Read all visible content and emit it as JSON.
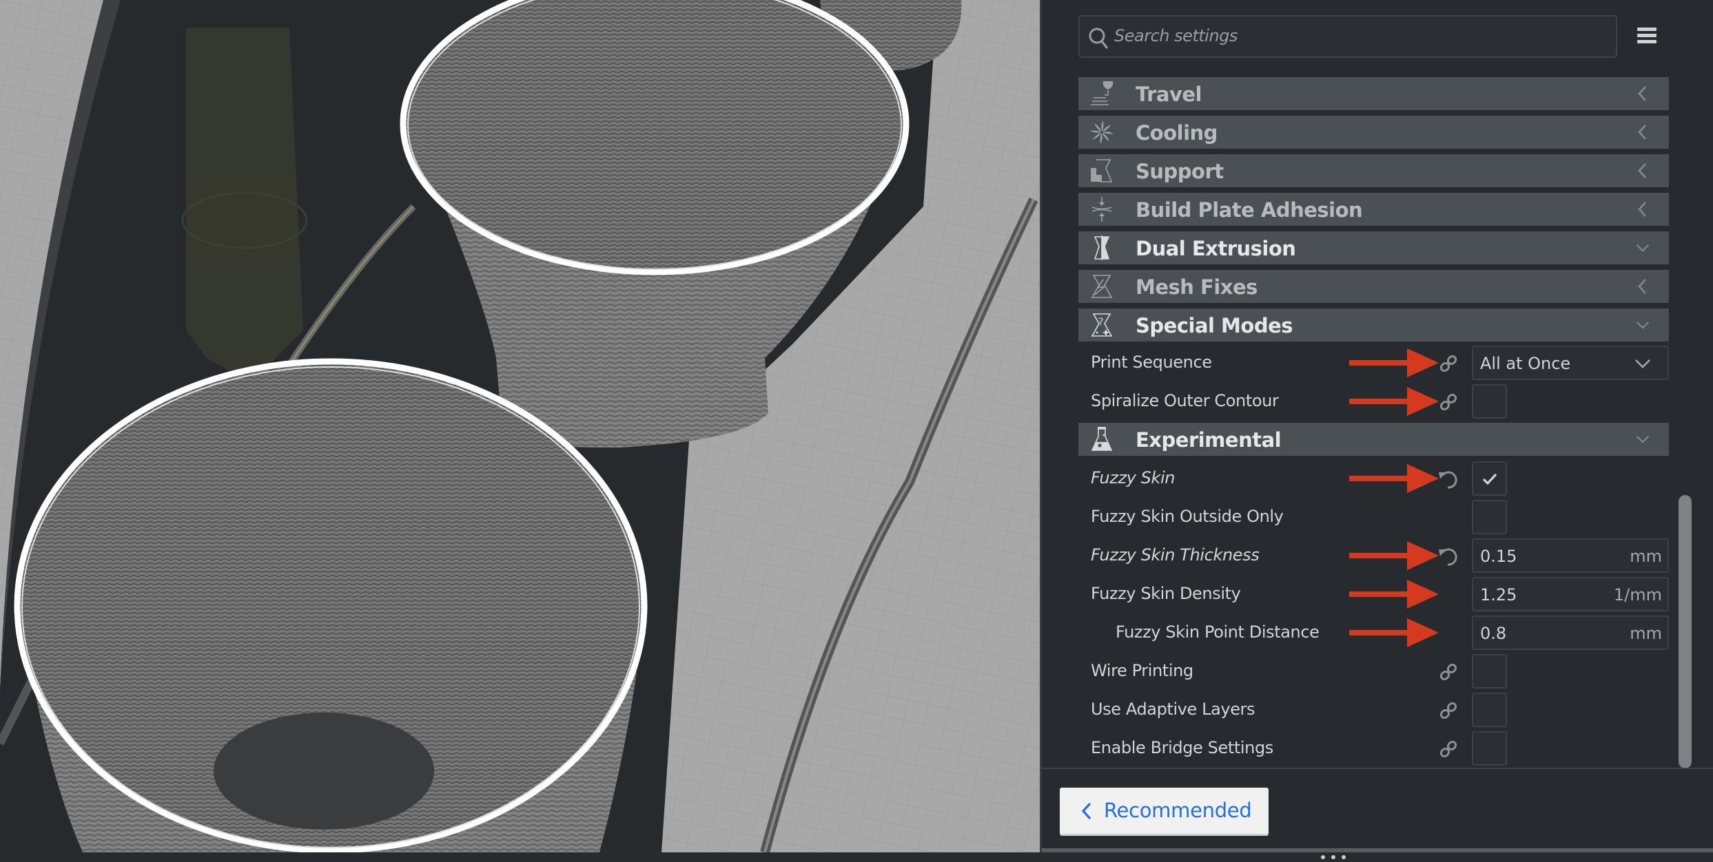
{
  "viewport": {
    "description": "3D preview of two fuzzy-skin printed cups on build plate",
    "colors": {
      "plate": "#a9a9a9",
      "grid": "#9b9b9b",
      "shadow": "#2a2e31",
      "model": "#7c7c7c",
      "highlight": "#ffffff",
      "nozzle": "#3e3d2c"
    }
  },
  "search": {
    "placeholder": "Search settings",
    "icon": "search-icon"
  },
  "menu": {
    "icon": "hamburger-menu-icon"
  },
  "sections": [
    {
      "id": "travel",
      "title": "Travel",
      "icon": "travel-icon",
      "state": "collapsed"
    },
    {
      "id": "cooling",
      "title": "Cooling",
      "icon": "fan-icon",
      "state": "collapsed"
    },
    {
      "id": "support",
      "title": "Support",
      "icon": "support-icon",
      "state": "collapsed"
    },
    {
      "id": "build-plate-adhesion",
      "title": "Build Plate Adhesion",
      "icon": "adhesion-icon",
      "state": "collapsed"
    },
    {
      "id": "dual-extrusion",
      "title": "Dual Extrusion",
      "icon": "dual-extrusion-icon",
      "state": "expanded"
    },
    {
      "id": "mesh-fixes",
      "title": "Mesh Fixes",
      "icon": "mesh-fixes-icon",
      "state": "collapsed"
    },
    {
      "id": "special-modes",
      "title": "Special Modes",
      "icon": "special-modes-icon",
      "state": "expanded"
    },
    {
      "id": "experimental",
      "title": "Experimental",
      "icon": "experimental-flask-icon",
      "state": "expanded"
    }
  ],
  "special_modes": {
    "print_sequence": {
      "label": "Print Sequence",
      "value": "All at Once",
      "status_icon": "link-icon",
      "annotated": true
    },
    "spiralize": {
      "label": "Spiralize Outer Contour",
      "checked": false,
      "status_icon": "link-icon",
      "annotated": true
    }
  },
  "experimental": {
    "fuzzy_skin": {
      "label": "Fuzzy Skin",
      "checked": true,
      "status_icon": "reset-icon",
      "annotated": true,
      "modified": true
    },
    "fuzzy_outside_only": {
      "label": "Fuzzy Skin Outside Only",
      "checked": false
    },
    "fuzzy_thickness": {
      "label": "Fuzzy Skin Thickness",
      "value": "0.15",
      "unit": "mm",
      "status_icon": "reset-icon",
      "annotated": true,
      "modified": true
    },
    "fuzzy_density": {
      "label": "Fuzzy Skin Density",
      "value": "1.25",
      "unit": "1/mm",
      "annotated": true
    },
    "fuzzy_point_distance": {
      "label": "Fuzzy Skin Point Distance",
      "value": "0.8",
      "unit": "mm",
      "annotated": true
    },
    "wire_printing": {
      "label": "Wire Printing",
      "checked": false,
      "status_icon": "link-icon"
    },
    "adaptive_layers": {
      "label": "Use Adaptive Layers",
      "checked": false,
      "status_icon": "link-icon"
    },
    "bridge_settings": {
      "label": "Enable Bridge Settings",
      "checked": false,
      "status_icon": "link-icon"
    }
  },
  "footer": {
    "recommended_label": "Recommended"
  },
  "colors": {
    "panel_bg": "#272b2f",
    "section_bg": "#4b5054",
    "annotation_arrow": "#d63a1e",
    "link_blue": "#2671d9",
    "scrollbar": "#7d8285"
  }
}
